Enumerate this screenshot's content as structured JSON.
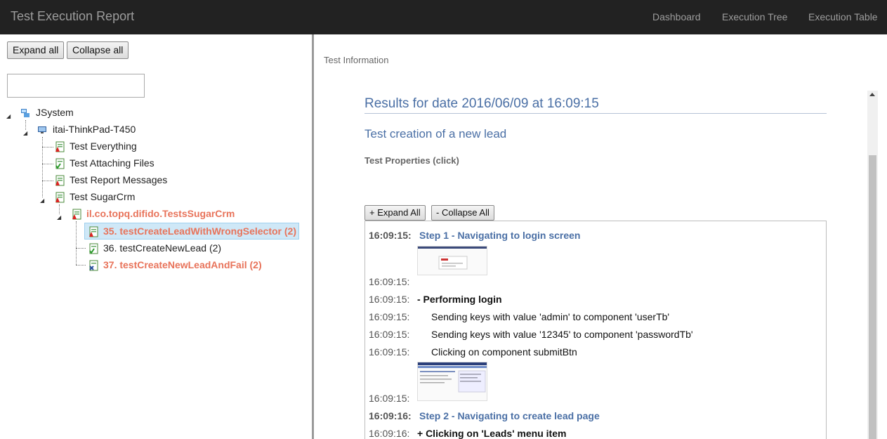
{
  "navbar": {
    "brand": "Test Execution Report",
    "links": [
      "Dashboard",
      "Execution Tree",
      "Execution Table"
    ]
  },
  "tree_panel": {
    "expand_all": "Expand all",
    "collapse_all": "Collapse all",
    "search_value": "",
    "nodes": [
      {
        "label": "JSystem",
        "icon": "network-computer-icon",
        "status": "expanded"
      },
      {
        "label": "itai-ThinkPad-T450",
        "icon": "monitor-icon",
        "status": "expanded"
      },
      {
        "label": "Test Everything",
        "icon": "report-warning-icon",
        "status": "warning"
      },
      {
        "label": "Test Attaching Files",
        "icon": "report-success-icon",
        "status": "success"
      },
      {
        "label": "Test Report Messages",
        "icon": "report-warning-icon",
        "status": "warning"
      },
      {
        "label": "Test SugarCrm",
        "icon": "report-warning-icon",
        "status": "warning"
      },
      {
        "label": "il.co.topq.difido.TestsSugarCrm",
        "icon": "report-warning-icon",
        "status": "warning"
      },
      {
        "label": "35. testCreateLeadWithWrongSelector (2)",
        "icon": "report-warning-icon",
        "status": "warning",
        "selected": true
      },
      {
        "label": "36. testCreateNewLead (2)",
        "icon": "report-success-icon",
        "status": "success"
      },
      {
        "label": "37. testCreateNewLeadAndFail (2)",
        "icon": "report-failure-icon",
        "status": "failure"
      }
    ]
  },
  "details": {
    "section_label": "Test Information",
    "results_title": "Results for date 2016/06/09 at 16:09:15",
    "test_name": "Test creation of a new lead",
    "properties_label": "Test Properties (click)",
    "expand_all": "+ Expand All",
    "collapse_all": "- Collapse All",
    "log": [
      {
        "time": "16:09:15:",
        "text": "Step 1 - Navigating to login screen",
        "kind": "step"
      },
      {
        "time": "16:09:15:",
        "text": "",
        "kind": "image"
      },
      {
        "time": "16:09:15:",
        "text": "- Performing login",
        "kind": "bold"
      },
      {
        "time": "16:09:15:",
        "text": "Sending keys with value 'admin' to component 'userTb'",
        "kind": "indent"
      },
      {
        "time": "16:09:15:",
        "text": "Sending keys with value '12345' to component 'passwordTb'",
        "kind": "indent"
      },
      {
        "time": "16:09:15:",
        "text": "Clicking on component submitBtn",
        "kind": "indent"
      },
      {
        "time": "16:09:15:",
        "text": "",
        "kind": "image"
      },
      {
        "time": "16:09:16:",
        "text": "Step 2 - Navigating to create lead page",
        "kind": "step"
      },
      {
        "time": "16:09:16:",
        "text": "+ Clicking on 'Leads' menu item",
        "kind": "bold"
      }
    ]
  },
  "colors": {
    "navbar_bg": "#222222",
    "navbar_text": "#9d9d9d",
    "heading_blue": "#4a6fa5",
    "failure_orange": "#e8735a",
    "selection_bg": "#cfe8f7"
  }
}
